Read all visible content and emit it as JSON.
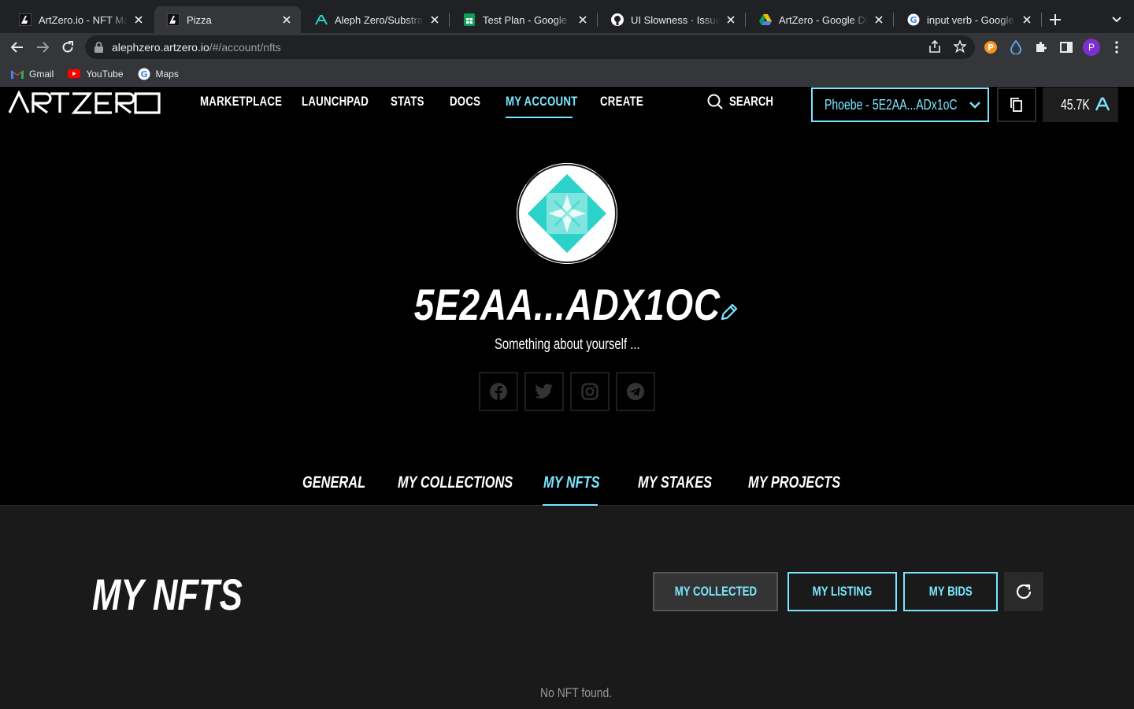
{
  "browser": {
    "tabs": [
      {
        "title": "ArtZero.io - NFT Marketplace",
        "icon": "artzero-icon",
        "active": false
      },
      {
        "title": "Pizza",
        "icon": "artzero-icon",
        "active": true
      },
      {
        "title": "Aleph Zero/Substrate",
        "icon": "aleph-zero-icon",
        "active": false
      },
      {
        "title": "Test Plan - Google Sheets",
        "icon": "google-sheets-icon",
        "active": false
      },
      {
        "title": "UI Slowness · Issue #",
        "icon": "github-icon",
        "active": false
      },
      {
        "title": "ArtZero - Google Drive",
        "icon": "google-drive-icon",
        "active": false
      },
      {
        "title": "input verb - Google Search",
        "icon": "google-icon",
        "active": false
      }
    ],
    "url_host": "alephzero.artzero.io",
    "url_path": "/#/account/nfts",
    "bookmarks": [
      {
        "label": "Gmail",
        "icon": "gmail-icon"
      },
      {
        "label": "YouTube",
        "icon": "youtube-icon"
      },
      {
        "label": "Maps",
        "icon": "google-maps-icon"
      }
    ],
    "profile_initial": "P"
  },
  "header": {
    "nav": [
      {
        "label": "MARKETPLACE",
        "active": false
      },
      {
        "label": "LAUNCHPAD",
        "active": false
      },
      {
        "label": "STATS",
        "active": false
      },
      {
        "label": "DOCS",
        "active": false
      },
      {
        "label": "MY ACCOUNT",
        "active": true
      },
      {
        "label": "CREATE",
        "active": false
      }
    ],
    "search_label": "SEARCH",
    "wallet_label": "Phoebe  - 5E2AA...ADx1oC",
    "balance": "45.7K"
  },
  "profile": {
    "name": "5E2AA...ADX1OC",
    "bio": "Something about yourself ...",
    "socials": [
      "facebook-icon",
      "twitter-icon",
      "instagram-icon",
      "telegram-icon"
    ]
  },
  "subtabs": [
    {
      "label": "GENERAL",
      "active": false
    },
    {
      "label": "MY COLLECTIONS",
      "active": false
    },
    {
      "label": "MY NFTS",
      "active": true
    },
    {
      "label": "MY STAKES",
      "active": false
    },
    {
      "label": "MY PROJECTS",
      "active": false
    }
  ],
  "panel": {
    "title": "MY NFTS",
    "filters": [
      {
        "label": "MY COLLECTED",
        "active": true
      },
      {
        "label": "MY LISTING",
        "active": false
      },
      {
        "label": "MY BIDS",
        "active": false
      }
    ],
    "empty_text": "No NFT found."
  },
  "colors": {
    "accent": "#7ae7ff",
    "background": "#000000",
    "panel": "#1a1a1a",
    "avatar_teal": "#2ad2c9"
  }
}
